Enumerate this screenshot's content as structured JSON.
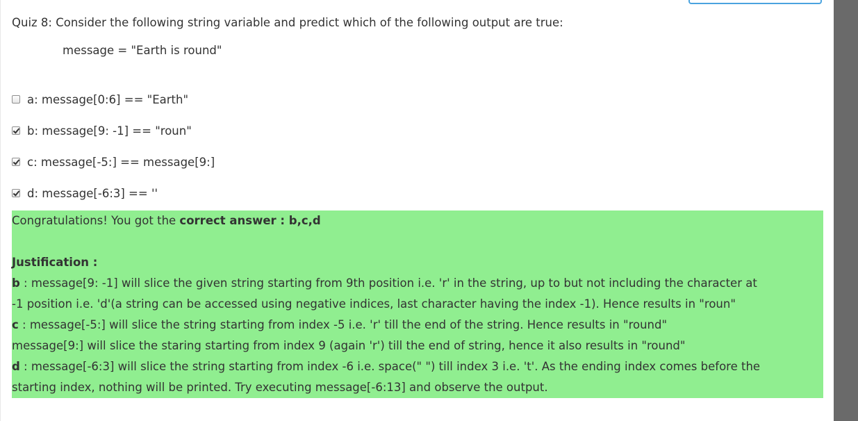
{
  "quiz": {
    "question": "Quiz 8: Consider the following string variable and predict which of the following output are true:",
    "code": "message = \"Earth is round\"",
    "options": [
      {
        "label": "a: message[0:6] == \"Earth\"",
        "checked": false
      },
      {
        "label": "b: message[9: -1] == \"roun\"",
        "checked": true
      },
      {
        "label": "c: message[-5:] == message[9:]",
        "checked": true
      },
      {
        "label": "d: message[-6:3] == ''",
        "checked": true
      }
    ]
  },
  "feedback": {
    "congrats_prefix": "Congratulations! You got the ",
    "correct_answer": "correct answer : b,c,d",
    "justification_title": "Justification :",
    "b_key": "b",
    "b_text1": " : message[9: -1] will slice the given string starting from 9th position i.e. 'r' in the string, up to but not including the character at",
    "b_text2": "-1 position i.e. 'd'(a string can be accessed using negative indices, last character having the index -1). Hence results in \"roun\"",
    "c_key": "c",
    "c_text1": " : message[-5:] will slice the string starting from index -5 i.e. 'r' till the end of the string. Hence results in \"round\"",
    "c_text2": "message[9:] will slice the staring starting from index 9 (again 'r') till the end of string, hence it also results in \"round\"",
    "d_key": "d",
    "d_text1": " : message[-6:3] will slice the string starting from index -6 i.e. space(\" \") till index 3 i.e. 't'. As the ending index comes before the",
    "d_text2": "starting index, nothing will be printed. Try executing message[-6:13] and observe the output."
  },
  "colors": {
    "feedback_bg": "#90ee90",
    "text": "#333333",
    "scrollbar": "#6a6a6a"
  }
}
